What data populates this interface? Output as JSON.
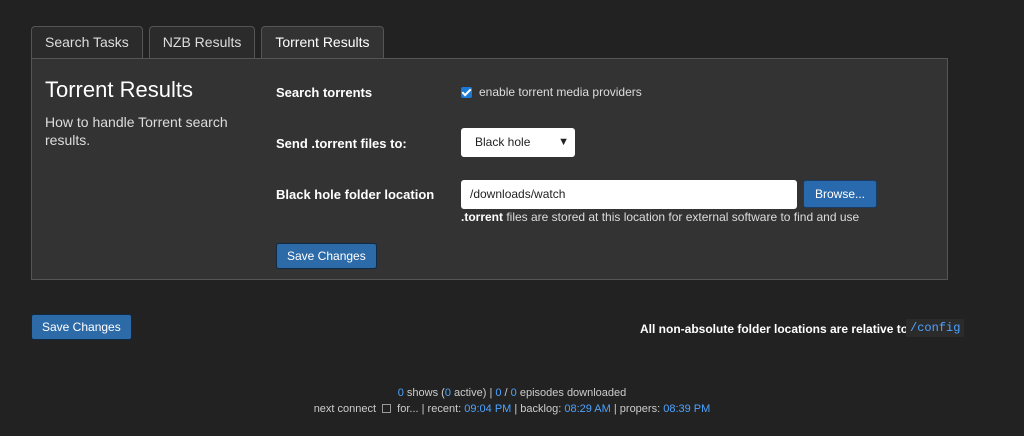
{
  "tabs": [
    {
      "label": "Search Tasks"
    },
    {
      "label": "NZB Results"
    },
    {
      "label": "Torrent Results"
    }
  ],
  "section": {
    "title": "Torrent Results",
    "description": "How to handle Torrent search results."
  },
  "fields": {
    "search_torrents_label": "Search torrents",
    "enable_checkbox_label": "enable torrent media providers",
    "enable_checked": true,
    "send_label": "Send .torrent files to:",
    "send_value": "Black hole",
    "folder_label": "Black hole folder location",
    "folder_value": "/downloads/watch",
    "browse_label": "Browse...",
    "hint_bold": ".torrent",
    "hint_rest": " files are stored at this location for external software to find and use"
  },
  "buttons": {
    "save_inner": "Save Changes",
    "save_outer": "Save Changes"
  },
  "relative_note": "All non-absolute folder locations are relative to",
  "config_path": "/config",
  "footer": {
    "shows": "0",
    "shows_text": " shows (",
    "active": "0",
    "active_text": " active) | ",
    "episodes_downloaded": "0",
    "slash": " / ",
    "episodes_total": "0",
    "episodes_text": " episodes downloaded",
    "next_connect_text": "next connect ",
    "for_text": " for... | recent: ",
    "recent_time": "09:04 PM",
    "backlog_text": " | backlog: ",
    "backlog_time": "08:29 AM",
    "propers_text": " | propers: ",
    "propers_time": "08:39 PM"
  },
  "colors": {
    "background": "#222222",
    "panel": "#333333",
    "accent": "#2d6aa8",
    "link": "#4da3ff"
  }
}
